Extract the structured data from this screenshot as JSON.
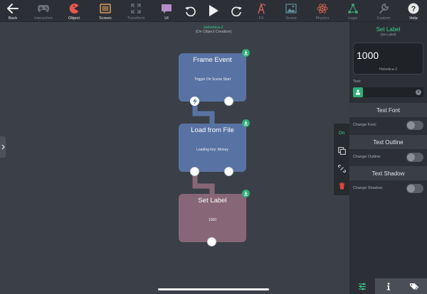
{
  "toolbar": {
    "items": [
      {
        "label": "Back",
        "icon": "back-arrow-icon",
        "state": "enabled"
      },
      {
        "label": "Interaction",
        "icon": "gamepad-icon",
        "state": "disabled"
      },
      {
        "label": "Object",
        "icon": "pacman-icon",
        "state": "enabled"
      },
      {
        "label": "Screen",
        "icon": "screen-icon",
        "state": "enabled"
      },
      {
        "label": "Transform",
        "icon": "expand-arrows-icon",
        "state": "disabled"
      },
      {
        "label": "UI",
        "icon": "chat-bubble-icon",
        "state": "enabled"
      },
      {
        "label": "",
        "icon": "undo-icon",
        "state": "enabled"
      },
      {
        "label": "",
        "icon": "play-icon",
        "state": "enabled"
      },
      {
        "label": "",
        "icon": "redo-icon",
        "state": "enabled"
      },
      {
        "label": "FX",
        "icon": "fx-icon",
        "state": "disabled"
      },
      {
        "label": "Scene",
        "icon": "landscape-icon",
        "state": "disabled"
      },
      {
        "label": "Physics",
        "icon": "atom-icon",
        "state": "disabled"
      },
      {
        "label": "Logic",
        "icon": "network-icon",
        "state": "disabled"
      },
      {
        "label": "Custom",
        "icon": "wrench-icon",
        "state": "disabled"
      },
      {
        "label": "Help",
        "icon": "help-icon",
        "state": "enabled"
      }
    ]
  },
  "canvas": {
    "font_name": "Helvetica-2",
    "context": "(On Object Creation)"
  },
  "nodes": [
    {
      "title": "Frame Event",
      "subtitle": "Trigger On Scene Start"
    },
    {
      "title": "Load from File",
      "subtitle": "Loading key: Money"
    },
    {
      "title": "Set Label",
      "subtitle": "1000"
    }
  ],
  "mini_toolbar": {
    "on_label": "On"
  },
  "panel": {
    "title": "Set Label",
    "subtitle": "(Set Label)",
    "preview_value": "1000",
    "preview_font": "Helvetica-2",
    "text_label": "Text:",
    "text_value": "",
    "sections": [
      {
        "header": "Text Font",
        "row_label": "Change Font:",
        "toggle_on": false
      },
      {
        "header": "Text Outline",
        "row_label": "Change Outline:",
        "toggle_on": false
      },
      {
        "header": "Text Shadow",
        "row_label": "Change Shadow:",
        "toggle_on": false
      }
    ],
    "tabs": [
      {
        "icon": "sliders-icon",
        "active": true
      },
      {
        "icon": "info-icon",
        "active": false
      },
      {
        "icon": "tags-icon",
        "active": false
      }
    ]
  },
  "colors": {
    "accent_green": "#3bd08e",
    "node_blue": "#5873a3",
    "node_purple": "#876777",
    "delete_red": "#e0453a"
  }
}
